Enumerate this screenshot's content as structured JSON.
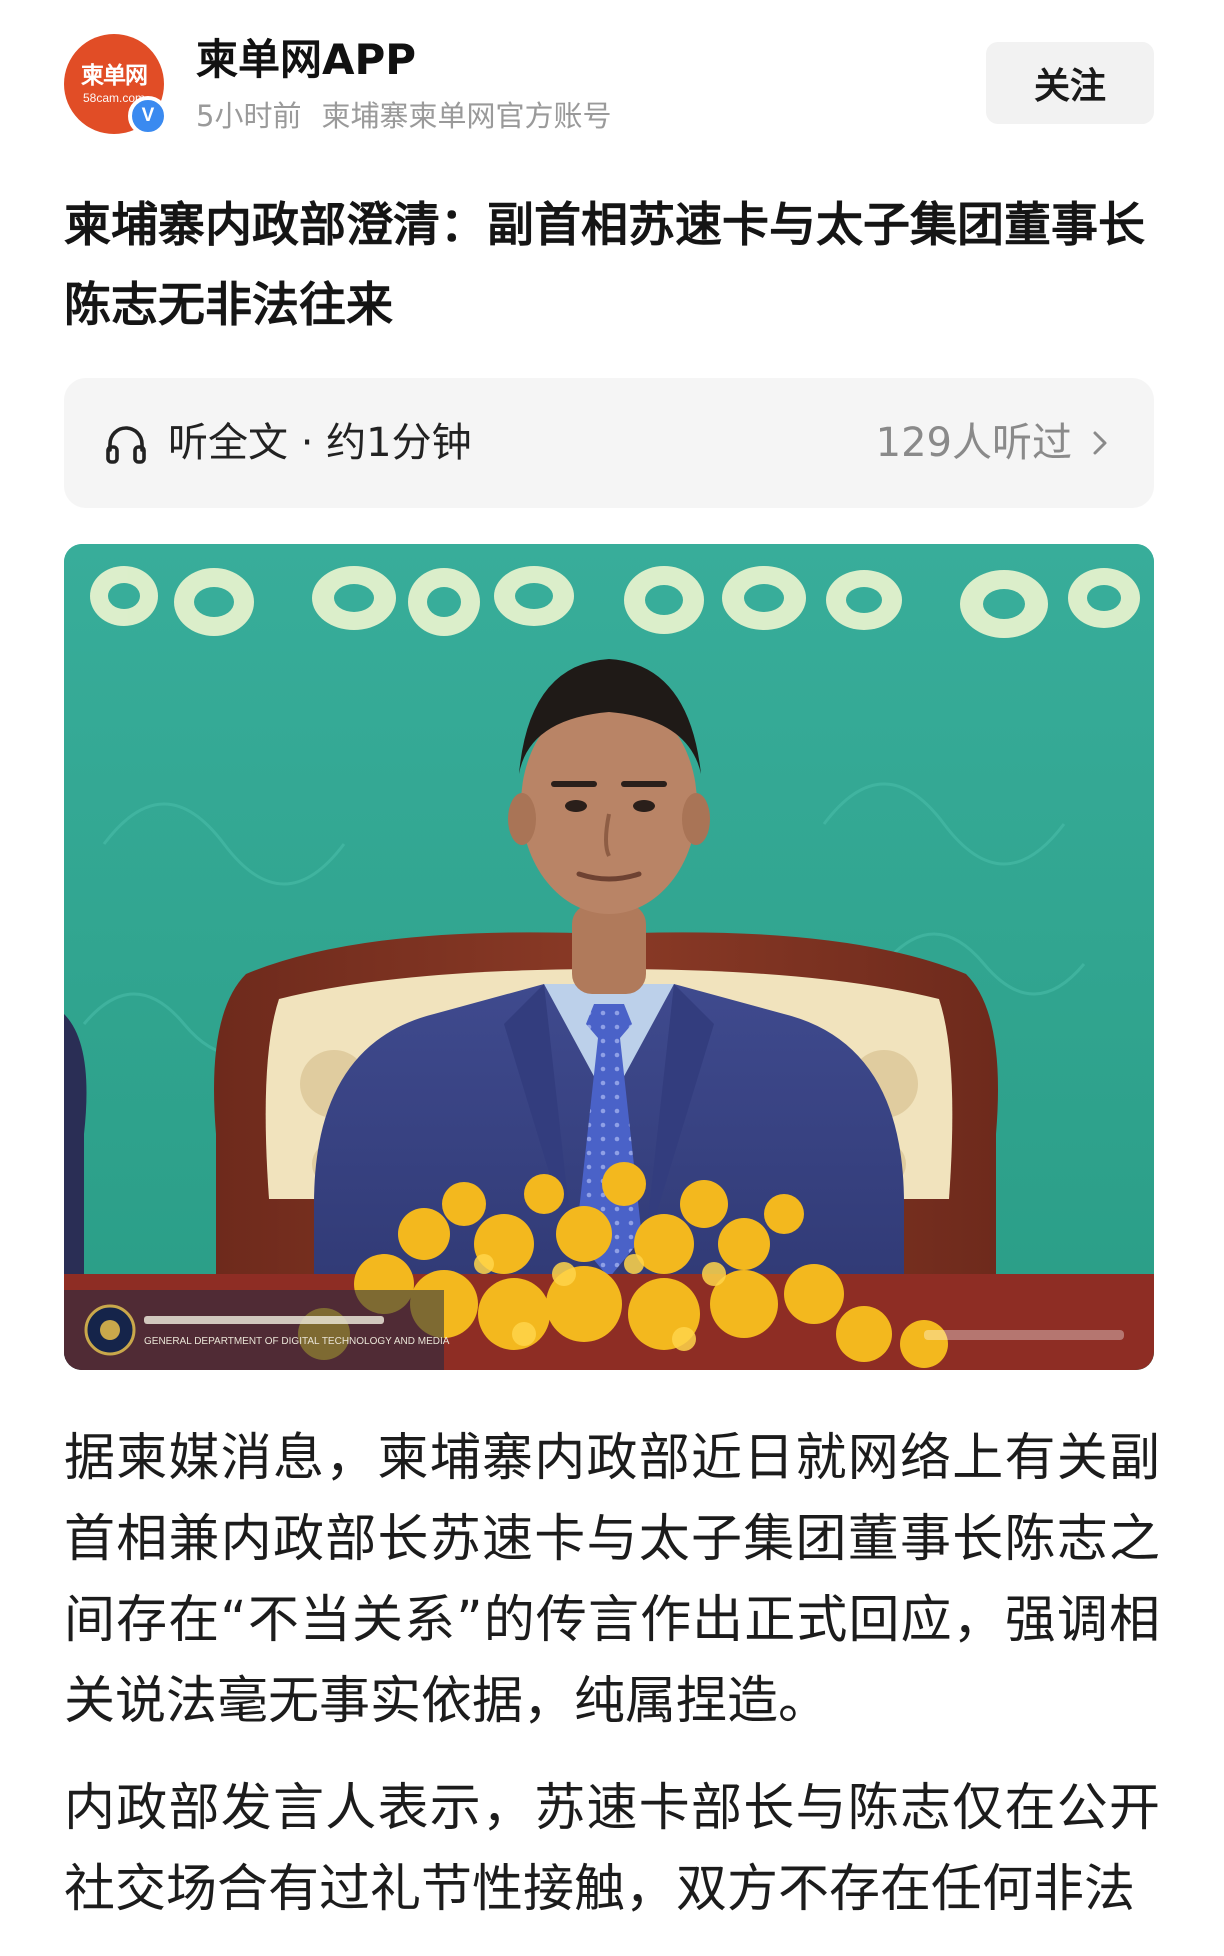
{
  "header": {
    "avatar_text": "柬单网",
    "avatar_sub": "58cam.com",
    "verified_mark": "V",
    "account_name": "柬单网APP",
    "time_ago": "5小时前",
    "account_desc": "柬埔寨柬单网官方账号",
    "follow_label": "关注"
  },
  "article": {
    "title": "柬埔寨内政部澄清：副首相苏速卡与太子集团董事长陈志无非法往来",
    "listen": {
      "label": "听全文 · 约1分钟",
      "count": "129人听过",
      "icon": "headphone-icon"
    },
    "image": {
      "caption_text": "GENERAL DEPARTMENT OF DIGITAL TECHNOLOGY AND MEDIA"
    },
    "paragraphs": [
      "据柬媒消息，柬埔寨内政部近日就网络上有关副首相兼内政部长苏速卡与太子集团董事长陈志之间存在“不当关系”的传言作出正式回应，强调相关说法毫无事实依据，纯属捏造。",
      "内政部发言人表示，苏速卡部长与陈志仅在公开社交场合有过礼节性接触，双方不存在任何非法"
    ]
  },
  "colors": {
    "accent_orange": "#e14d26",
    "verified_blue": "#3a8af0",
    "backdrop_teal": "#2fa691"
  }
}
